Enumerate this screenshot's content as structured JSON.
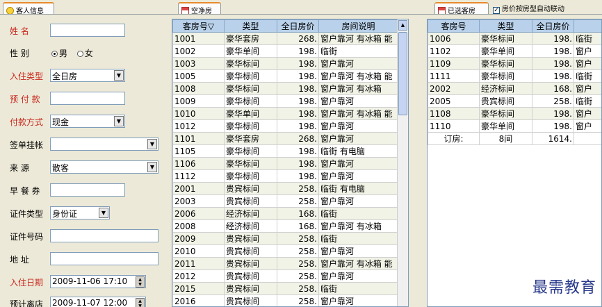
{
  "tabs": {
    "guest_info": "客人信息",
    "vacant_rooms": "空净房",
    "selected_rooms": "已选客房",
    "auto_link_label": "房价按房型自动联动"
  },
  "form": {
    "name_label": "姓    名",
    "name_value": "",
    "sex_label": "性    别",
    "sex_male": "男",
    "sex_female": "女",
    "stay_type_label": "入住类型",
    "stay_type_value": "全日房",
    "deposit_label": "预 付 款",
    "deposit_value": "",
    "payment_label": "付款方式",
    "payment_value": "现金",
    "sign_label": "签单挂帐",
    "sign_value": "",
    "source_label": "来    源",
    "source_value": "散客",
    "breakfast_label": "早 餐 券",
    "breakfast_value": "",
    "id_type_label": "证件类型",
    "id_type_value": "身份证",
    "id_no_label": "证件号码",
    "id_no_value": "",
    "address_label": "地    址",
    "address_value": "",
    "checkin_label": "入住日期",
    "checkin_value": "2009-11-06 17:10",
    "checkout_label": "预计离店",
    "checkout_value": "2009-11-07 12:00"
  },
  "vacant_table": {
    "headers": [
      "客房号▽",
      "类型",
      "全日房价",
      "房间说明"
    ],
    "rows": [
      [
        "1001",
        "豪华套房",
        "268.",
        "窗户靠河 有冰箱 能"
      ],
      [
        "1002",
        "豪华单间",
        "198.",
        "临街"
      ],
      [
        "1003",
        "豪华标间",
        "198.",
        "窗户靠河"
      ],
      [
        "1005",
        "豪华标间",
        "198.",
        "窗户靠河 有冰箱 能"
      ],
      [
        "1008",
        "豪华标间",
        "198.",
        "窗户靠河 有冰箱"
      ],
      [
        "1009",
        "豪华标间",
        "198.",
        "窗户靠河"
      ],
      [
        "1010",
        "豪华单间",
        "198.",
        "窗户靠河 有冰箱 能"
      ],
      [
        "1012",
        "豪华标间",
        "198.",
        "窗户靠河"
      ],
      [
        "1101",
        "豪华套房",
        "268.",
        "窗户靠河"
      ],
      [
        "1105",
        "豪华标间",
        "198.",
        "临街 有电脑"
      ],
      [
        "1106",
        "豪华标间",
        "198.",
        "窗户靠河"
      ],
      [
        "1112",
        "豪华标间",
        "198.",
        "窗户靠河"
      ],
      [
        "2001",
        "贵宾标间",
        "258.",
        "临街 有电脑"
      ],
      [
        "2003",
        "贵宾标间",
        "258.",
        "窗户靠河"
      ],
      [
        "2006",
        "经济标间",
        "168.",
        "临街"
      ],
      [
        "2008",
        "经济标间",
        "168.",
        "窗户靠河 有冰箱"
      ],
      [
        "2009",
        "贵宾标间",
        "258.",
        "临街"
      ],
      [
        "2010",
        "贵宾标间",
        "258.",
        "窗户靠河"
      ],
      [
        "2011",
        "贵宾标间",
        "258.",
        "窗户靠河 有冰箱 能"
      ],
      [
        "2012",
        "贵宾标间",
        "258.",
        "窗户靠河"
      ],
      [
        "2015",
        "贵宾标间",
        "258.",
        "临街"
      ],
      [
        "2016",
        "贵宾标间",
        "258.",
        "窗户靠河"
      ]
    ]
  },
  "selected_table": {
    "headers": [
      "客房号",
      "类型",
      "全日房价",
      ""
    ],
    "rows": [
      [
        "1006",
        "豪华标间",
        "198.",
        "临街"
      ],
      [
        "1102",
        "豪华单间",
        "198.",
        "窗户"
      ],
      [
        "1109",
        "豪华标间",
        "198.",
        "窗户"
      ],
      [
        "1111",
        "豪华标间",
        "198.",
        "临街"
      ],
      [
        "2002",
        "经济标间",
        "168.",
        "窗户"
      ],
      [
        "2005",
        "贵宾标间",
        "258.",
        "临街"
      ],
      [
        "1108",
        "豪华标间",
        "198.",
        "窗户"
      ],
      [
        "1110",
        "豪华单间",
        "198.",
        "窗户"
      ]
    ],
    "summary": [
      "订房:",
      "8间",
      "1614.",
      ""
    ]
  },
  "watermark": "最需教育"
}
